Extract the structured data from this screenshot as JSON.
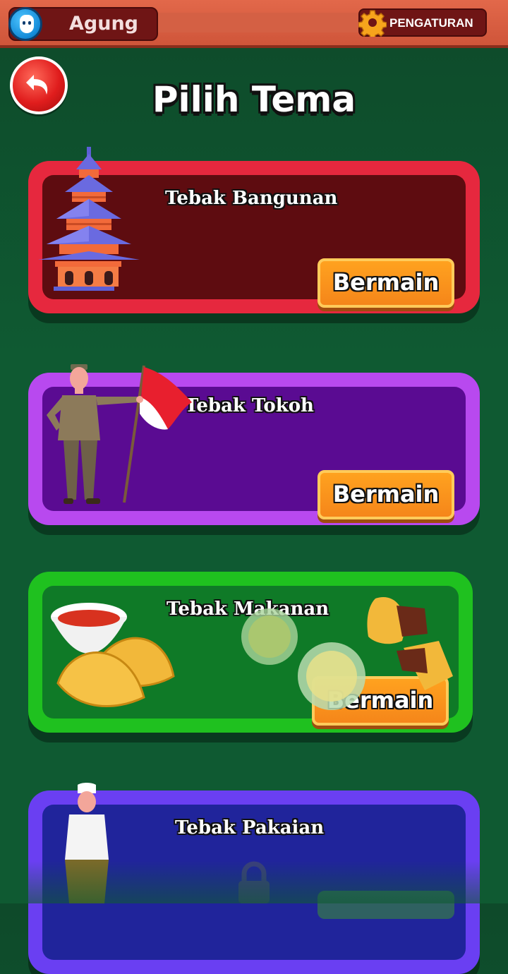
{
  "topbar": {
    "player_name": "Agung",
    "settings_label": "PENGATURAN",
    "settings_icon": "gear-icon",
    "avatar_icon": "player-avatar-icon"
  },
  "header": {
    "back_icon": "back-arrow-icon",
    "title": "Pilih Tema"
  },
  "themes": [
    {
      "title": "Tebak Bangunan",
      "button": "Bermain",
      "illustration": "pagoda-icon",
      "locked": false,
      "accent": "#e6283e"
    },
    {
      "title": "Tebak Tokoh",
      "button": "Bermain",
      "illustration": "hero-with-flag-icon",
      "locked": false,
      "accent": "#b849ef"
    },
    {
      "title": "Tebak Makanan",
      "button": "Bermain",
      "illustration": "food-icon",
      "locked": false,
      "accent": "#1fc11f"
    },
    {
      "title": "Tebak Pakaian",
      "button": "",
      "illustration": "traditional-clothing-icon",
      "locked": true,
      "accent": "#6a3ff2"
    }
  ]
}
